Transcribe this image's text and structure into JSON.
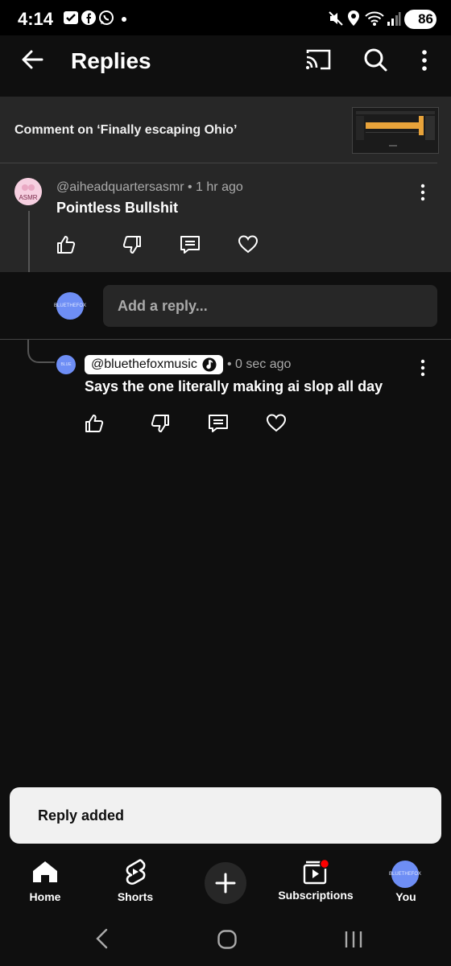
{
  "status_bar": {
    "time": "4:14",
    "battery": "86",
    "icons": [
      "gmail-icon",
      "facebook-icon",
      "whatsapp-icon",
      "dot-icon",
      "mute-icon",
      "location-icon",
      "wifi-icon",
      "signal-icon"
    ]
  },
  "app_bar": {
    "title": "Replies",
    "icons": [
      "back-arrow-icon",
      "cast-icon",
      "search-icon",
      "more-vert-icon"
    ]
  },
  "context": {
    "label": "Comment on ‘Finally escaping Ohio’"
  },
  "parent_comment": {
    "avatar_text": "ASMR",
    "author": "@aiheadquartersasmr",
    "time": "1 hr ago",
    "text": "Pointless Bullshit"
  },
  "reply_input": {
    "placeholder": "Add a reply...",
    "avatar_text": "BLUETHEFOX"
  },
  "reply": {
    "avatar_text": "BLUE",
    "author": "@bluethefoxmusic",
    "time": "0 sec ago",
    "text": "Says the one literally making ai slop all day"
  },
  "toast": {
    "text": "Reply added"
  },
  "bottom_nav": {
    "items": [
      "Home",
      "Shorts",
      "Subscriptions",
      "You"
    ],
    "you_avatar_text": "BLUETHEFOX"
  },
  "colors": {
    "background": "#0f0f0f",
    "surface": "#272727",
    "text": "#f1f1f1",
    "secondary_text": "#aaaaaa",
    "notification_dot": "#ff0000",
    "avatar_blue": "#6e8ef5"
  }
}
